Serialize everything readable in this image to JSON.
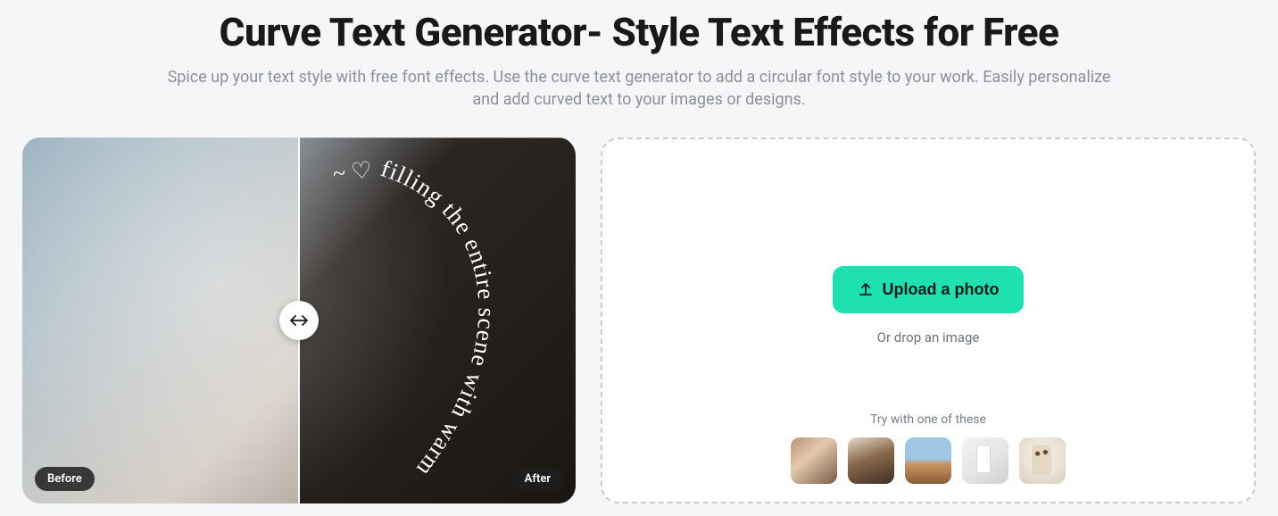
{
  "header": {
    "title": "Curve Text Generator- Style Text Effects for Free",
    "subtitle": "Spice up your text style with free font effects. Use the curve text generator to add a circular font style to your work. Easily personalize and add curved text to your images or designs."
  },
  "preview": {
    "before_label": "Before",
    "after_label": "After",
    "curved_text": "filling the entire scene with warmth",
    "doodle": "~ ♡"
  },
  "upload": {
    "button_label": "Upload a photo",
    "drop_hint": "Or drop an image",
    "samples_label": "Try with one of these",
    "samples": [
      {
        "name": "woman-sunglasses"
      },
      {
        "name": "man-curly-hair"
      },
      {
        "name": "desert-road"
      },
      {
        "name": "product-bottle"
      },
      {
        "name": "giraffe"
      }
    ]
  },
  "colors": {
    "accent": "#1fe1b0"
  }
}
